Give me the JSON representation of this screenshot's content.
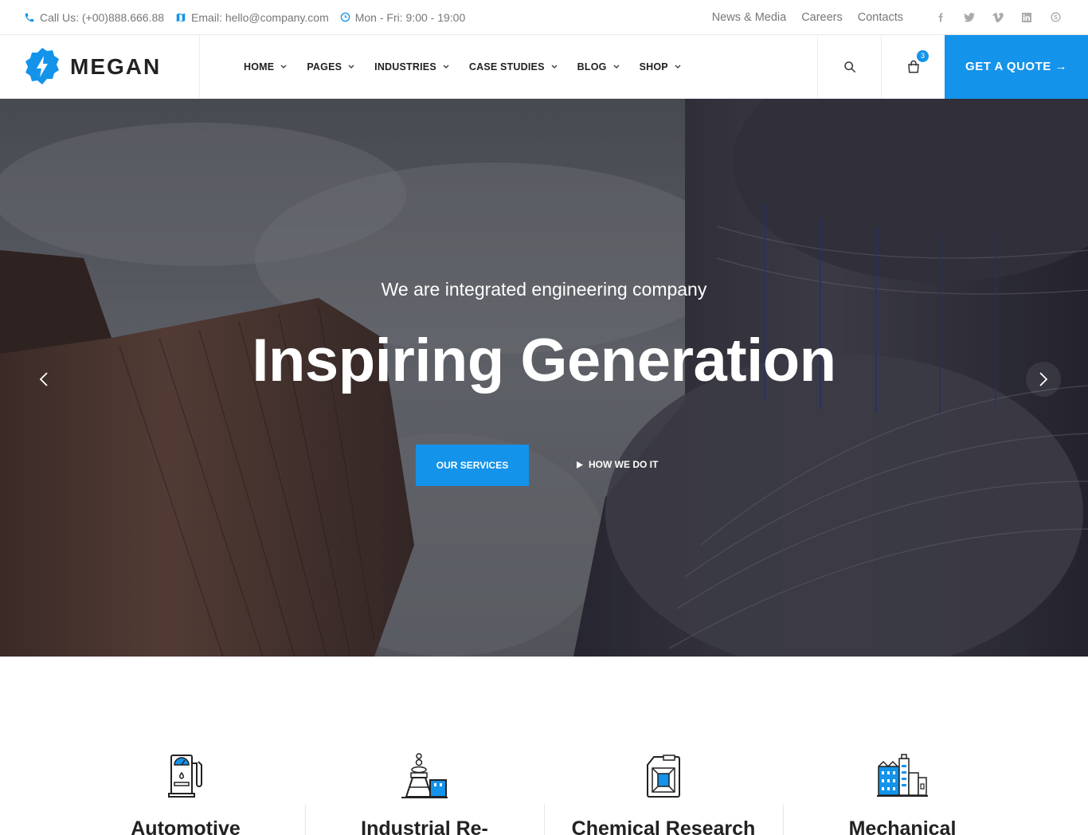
{
  "topbar": {
    "phone": "Call Us: (+00)888.666.88",
    "email": "Email: hello@company.com",
    "hours": "Mon - Fri: 9:00 - 19:00",
    "links": [
      "News & Media",
      "Careers",
      "Contacts"
    ],
    "socials": [
      "facebook-icon",
      "twitter-icon",
      "vimeo-icon",
      "linkedin-icon",
      "skype-icon"
    ]
  },
  "header": {
    "logo_text": "MEGAN",
    "nav": [
      "HOME",
      "PAGES",
      "INDUSTRIES",
      "CASE STUDIES",
      "BLOG",
      "SHOP"
    ],
    "cart_count": "3",
    "quote_label": "GET A QUOTE →"
  },
  "hero": {
    "subtitle": "We are integrated engineering company",
    "title": "Inspiring Generation",
    "primary_button": "OUR SERVICES",
    "secondary_button": "HOW WE DO IT"
  },
  "services": [
    {
      "title": "Automotive",
      "icon": "fuel-pump-icon"
    },
    {
      "title": "Industrial Re-",
      "icon": "refinery-icon"
    },
    {
      "title": "Chemical Research",
      "icon": "jerrycan-icon"
    },
    {
      "title": "Mechanical",
      "icon": "factory-icon"
    }
  ],
  "colors": {
    "accent": "#1493ea",
    "text_dark": "#222222",
    "text_muted": "#777777"
  }
}
